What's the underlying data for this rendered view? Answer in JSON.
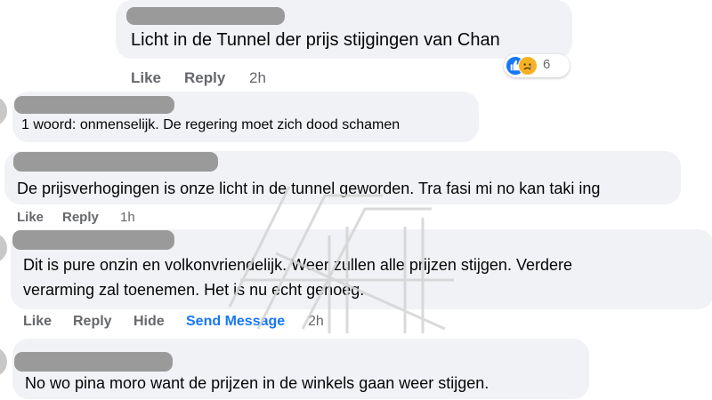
{
  "comments": [
    {
      "text": "Licht in de Tunnel der prijs stijgingen van Chan",
      "actions": {
        "like": "Like",
        "reply": "Reply",
        "time": "2h"
      },
      "reactions": {
        "icons": [
          "like-icon",
          "sad-icon"
        ],
        "count": "6"
      }
    },
    {
      "text": "1 woord: onmenselijk. De regering moet zich dood schamen"
    },
    {
      "text": "De prijsverhogingen is onze licht in de tunnel geworden. Tra fasi mi no kan taki ing",
      "actions": {
        "like": "Like",
        "reply": "Reply",
        "time": "1h"
      }
    },
    {
      "text_lines": [
        "Dit is pure onzin en volkonvriendelijk. Weer zullen alle prijzen stijgen. Verdere",
        "verarming zal toenemen. Het is nu echt genoeg."
      ],
      "actions": {
        "like": "Like",
        "reply": "Reply",
        "hide": "Hide",
        "send_message": "Send Message",
        "time": "2h"
      }
    },
    {
      "text": "No wo pina moro want de prijzen in de winkels gaan weer stijgen."
    }
  ],
  "colors": {
    "bubble": "#f0f2f5",
    "redaction": "#9a9a9a",
    "action_text": "#65676b",
    "link": "#1877f2",
    "like_reaction": "#1877f2",
    "sad_reaction": "#f7b125"
  }
}
